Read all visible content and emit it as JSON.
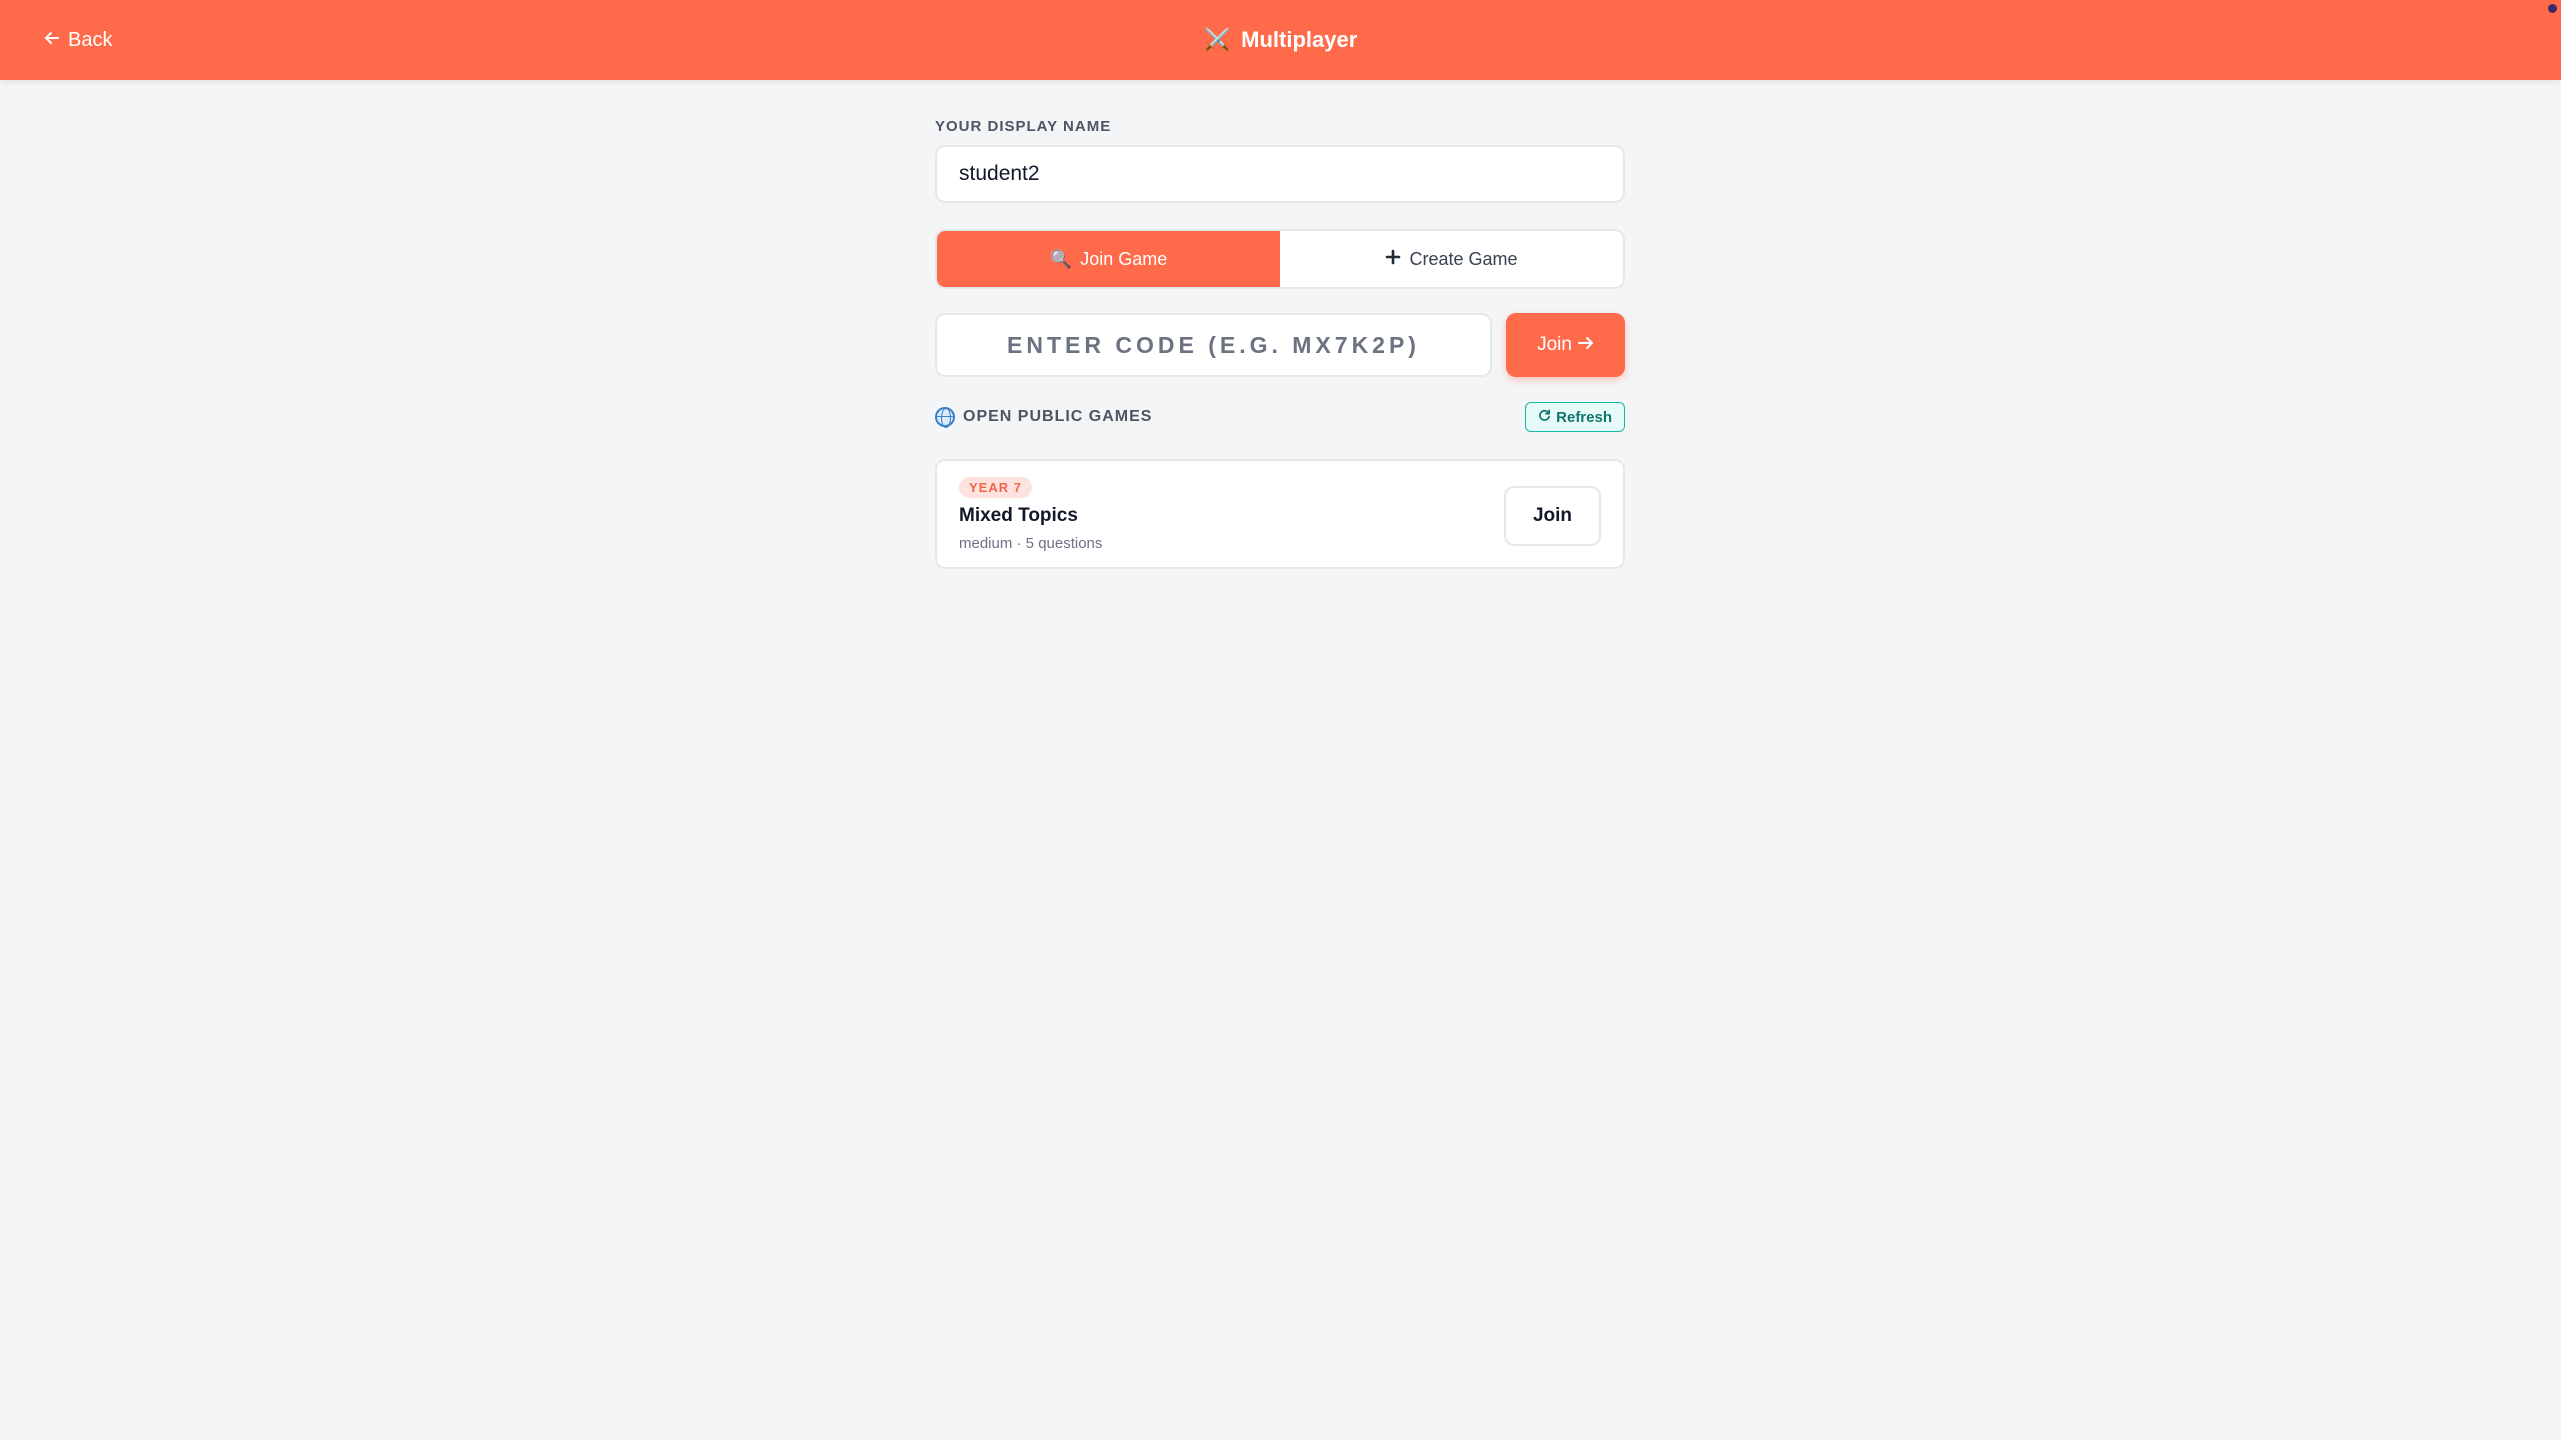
{
  "header": {
    "back_label": "Back",
    "title": "Multiplayer",
    "title_icon": "crossed-swords-icon",
    "background": "#ff6b4a"
  },
  "display_name": {
    "label": "YOUR DISPLAY NAME",
    "value": "student2"
  },
  "mode_toggle": {
    "join_label": "Join Game",
    "create_label": "Create Game",
    "selected": "Join Game"
  },
  "code_entry": {
    "placeholder": "ENTER CODE (E.G. MX7K2P)",
    "value": "",
    "join_label": "Join"
  },
  "public_games": {
    "title": "OPEN PUBLIC GAMES",
    "refresh_label": "Refresh",
    "games": [
      {
        "badge": "YEAR 7",
        "title": "Mixed Topics",
        "meta": "medium · 5 questions",
        "join_label": "Join"
      }
    ]
  },
  "colors": {
    "accent": "#ff6b4a",
    "refresh": "#14b8a6",
    "badge_bg": "#fde2dd"
  }
}
